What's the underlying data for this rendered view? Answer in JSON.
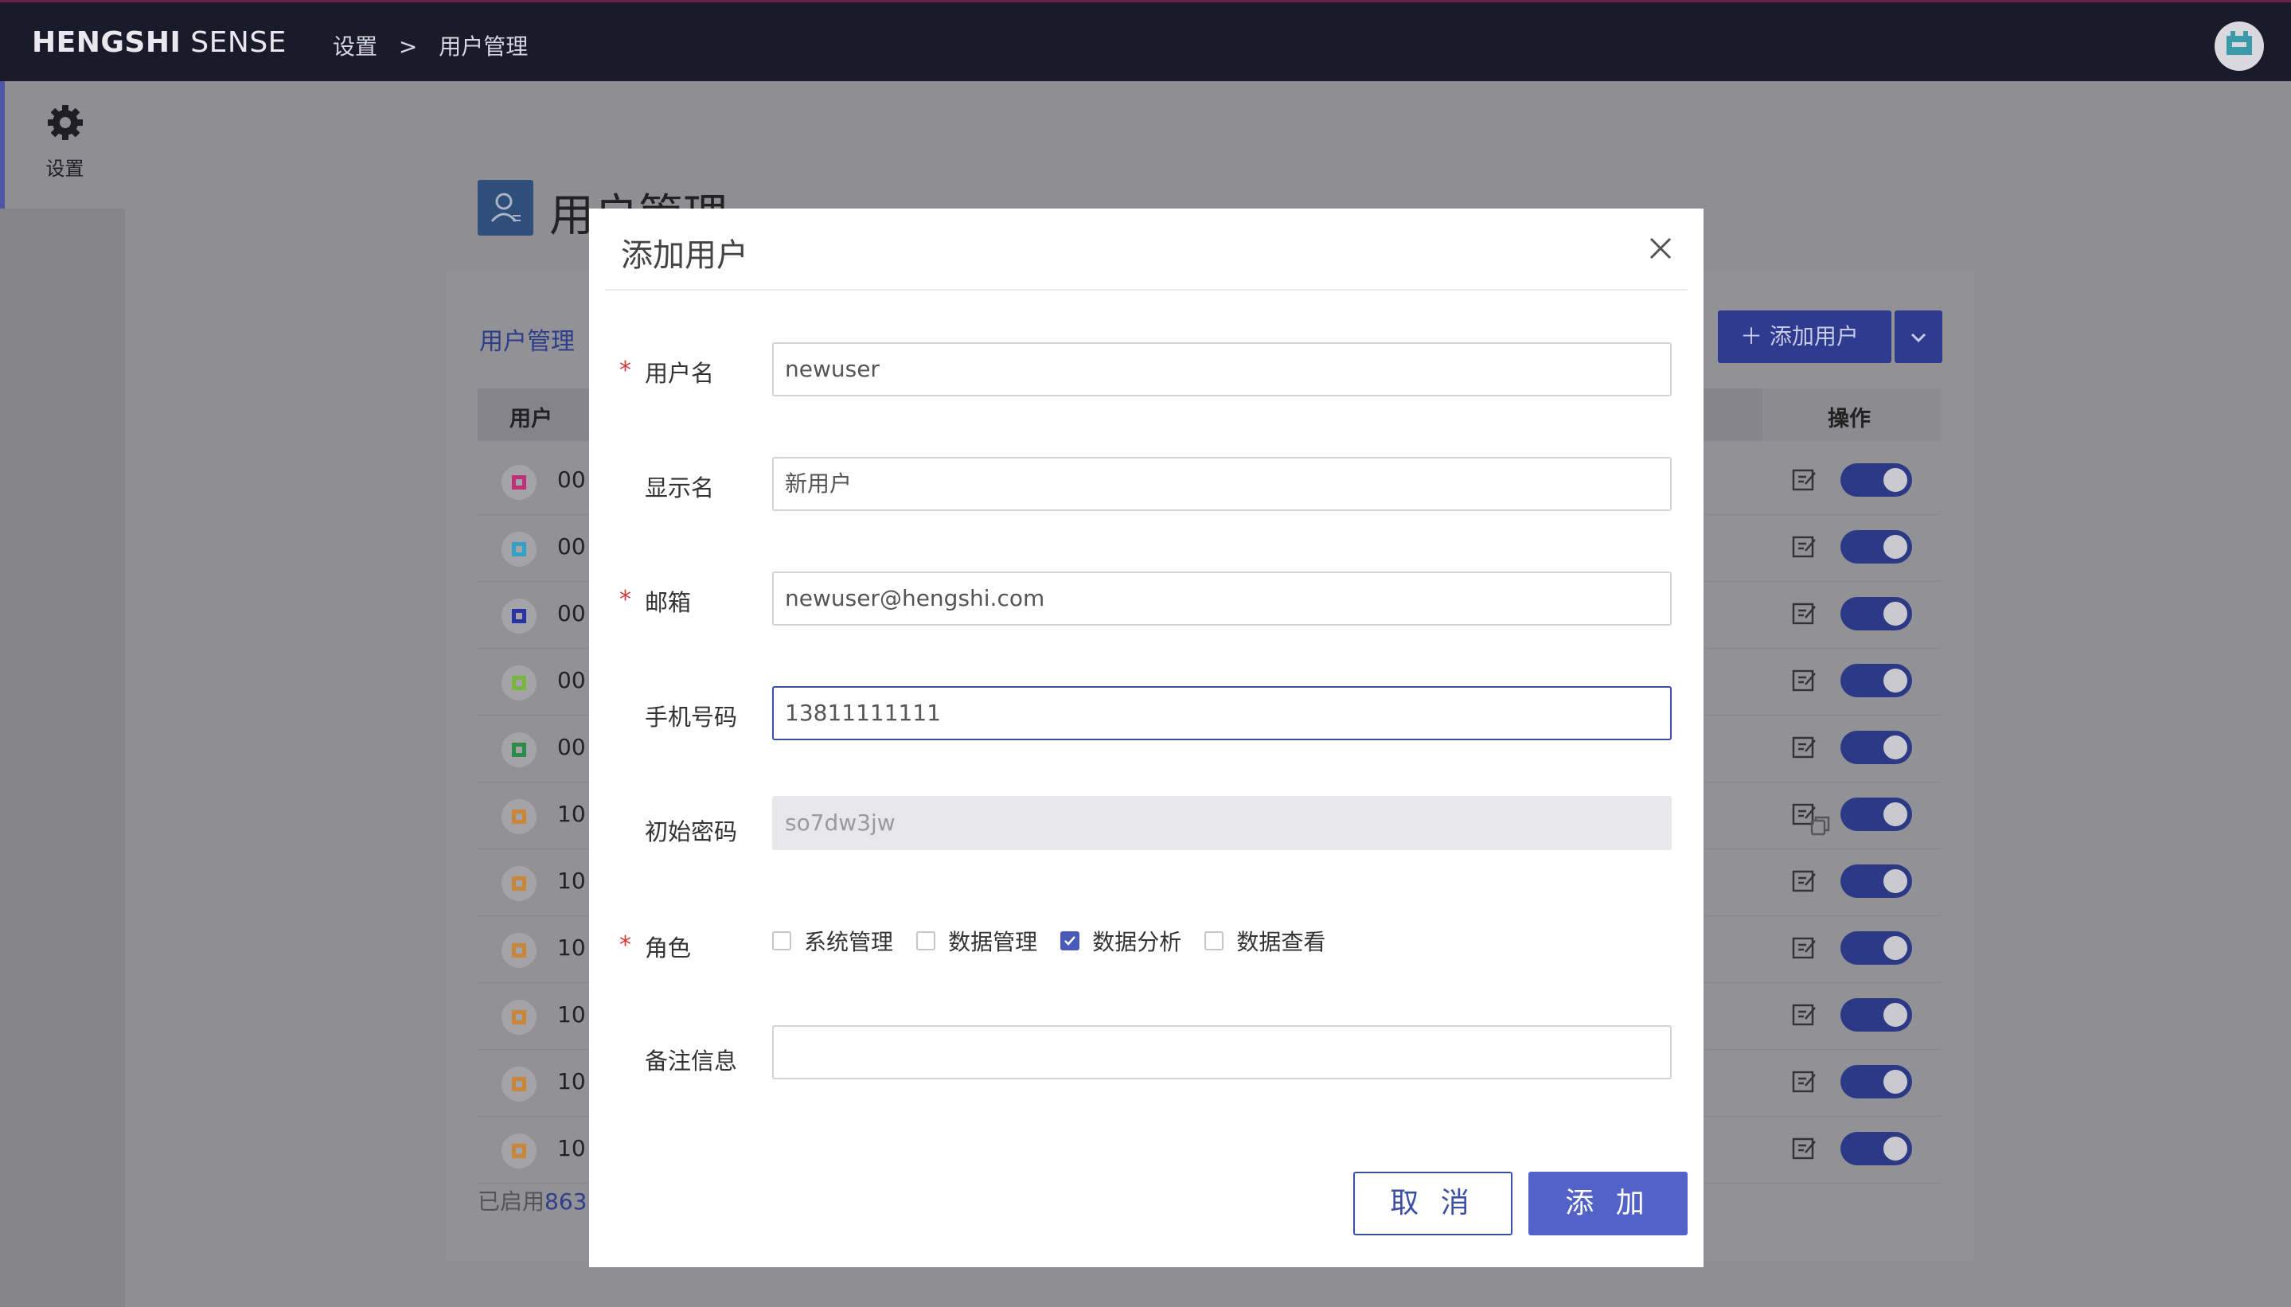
{
  "app": {
    "brand_bold": "HENGSHI",
    "brand_rest": " SENSE",
    "breadcrumb": [
      "设置",
      ">",
      "用户管理"
    ]
  },
  "sidebar": {
    "items": [
      {
        "label": "设置",
        "icon": "gear-icon"
      }
    ]
  },
  "page": {
    "title": "用户管理",
    "subtitle": "用户管理",
    "add_user_label": "添加用户",
    "table": {
      "columns": {
        "user": "用户",
        "ops": "操作"
      },
      "rows": [
        {
          "id": "00",
          "avatar_color": "#c0307a"
        },
        {
          "id": "00",
          "avatar_color": "#34a0c8"
        },
        {
          "id": "00",
          "avatar_color": "#2a33a6"
        },
        {
          "id": "00",
          "avatar_color": "#76b640"
        },
        {
          "id": "00",
          "avatar_color": "#2d8a48"
        },
        {
          "id": "10",
          "avatar_color": "#c8873a"
        },
        {
          "id": "10",
          "avatar_color": "#c8873a"
        },
        {
          "id": "10",
          "avatar_color": "#c8873a"
        },
        {
          "id": "10",
          "avatar_color": "#c8873a"
        },
        {
          "id": "10",
          "avatar_color": "#c8873a"
        },
        {
          "id": "10",
          "avatar_color": "#c8873a"
        }
      ]
    },
    "footer": {
      "prefix": "已启用",
      "count": "863"
    }
  },
  "modal": {
    "title": "添加用户",
    "fields": {
      "username": {
        "label": "用户名",
        "value": "newuser",
        "required": "*"
      },
      "display_name": {
        "label": "显示名",
        "value": "新用户"
      },
      "email": {
        "label": "邮箱",
        "value": "newuser@hengshi.com",
        "required": "*"
      },
      "phone": {
        "label": "手机号码",
        "value": "13811111111"
      },
      "password": {
        "label": "初始密码",
        "value": "so7dw3jw"
      },
      "roles": {
        "label": "角色",
        "required": "*",
        "options": [
          {
            "label": "系统管理",
            "checked": false
          },
          {
            "label": "数据管理",
            "checked": false
          },
          {
            "label": "数据分析",
            "checked": true
          },
          {
            "label": "数据查看",
            "checked": false
          }
        ]
      },
      "notes": {
        "label": "备注信息",
        "value": ""
      }
    },
    "cancel_label": "取 消",
    "submit_label": "添 加"
  },
  "colors": {
    "accent": "#5262c7",
    "topbar": "#1b1a2b",
    "required": "#d23a3a"
  }
}
